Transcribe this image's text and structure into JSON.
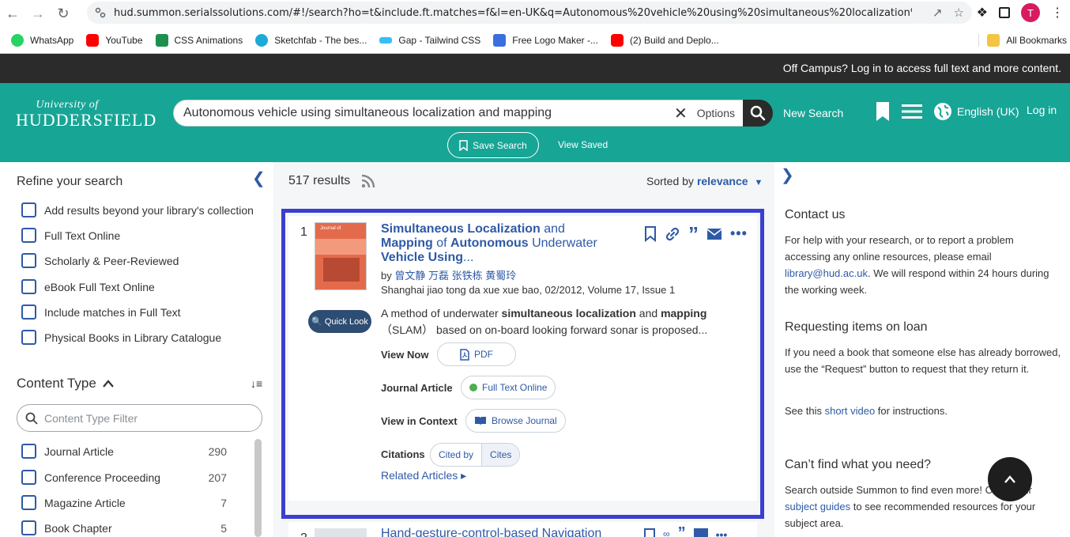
{
  "browser": {
    "url": "hud.summon.serialssolutions.com/#!/search?ho=t&include.ft.matches=f&l=en-UK&q=Autonomous%20vehicle%20using%20simultaneous%20localization%20and...",
    "profile_initial": "T",
    "bookmarks": [
      {
        "label": "WhatsApp",
        "color": "#25d366"
      },
      {
        "label": "YouTube",
        "color": "#ff0000"
      },
      {
        "label": "CSS Animations",
        "color": "#1f8f4e"
      },
      {
        "label": "Sketchfab - The bes...",
        "color": "#1caad9"
      },
      {
        "label": "Gap - Tailwind CSS",
        "color": "#38bdf8"
      },
      {
        "label": "Free Logo Maker -...",
        "color": "#3b6fe0"
      },
      {
        "label": "(2) Build and Deplo...",
        "color": "#ff0000"
      }
    ],
    "all_bookmarks": "All Bookmarks"
  },
  "site": {
    "offcampus": "Off Campus? Log in to access full text and more content.",
    "logo_line1": "University of",
    "logo_line2": "HUDDERSFIELD",
    "search_query": "Autonomous vehicle using simultaneous localization and mapping",
    "options": "Options",
    "new_search": "New Search",
    "language": "English (UK)",
    "login": "Log in",
    "save_search": "Save Search",
    "view_saved": "View Saved"
  },
  "sidebar": {
    "title": "Refine your search",
    "filters": [
      "Add results beyond your library's collection",
      "Full Text Online",
      "Scholarly & Peer-Reviewed",
      "eBook Full Text Online",
      "Include matches in Full Text",
      "Physical Books in Library Catalogue"
    ],
    "content_type_title": "Content Type",
    "content_type_placeholder": "Content Type Filter",
    "content_types": [
      {
        "label": "Journal Article",
        "count": "290"
      },
      {
        "label": "Conference Proceeding",
        "count": "207"
      },
      {
        "label": "Magazine Article",
        "count": "7"
      },
      {
        "label": "Book Chapter",
        "count": "5"
      }
    ]
  },
  "results": {
    "count": "517 results",
    "sorted_by": "Sorted by",
    "sort_value": "relevance",
    "item1": {
      "number": "1",
      "title_parts": [
        {
          "text": "Simultaneous Localization",
          "bold": true
        },
        {
          "text": " and ",
          "bold": false
        },
        {
          "text": "Mapping",
          "bold": true
        },
        {
          "text": " of ",
          "bold": false
        },
        {
          "text": "Autonomous",
          "bold": true
        },
        {
          "text": " Underwater ",
          "bold": false
        },
        {
          "text": "Vehicle Using",
          "bold": true
        },
        {
          "text": "...",
          "bold": false
        }
      ],
      "authors_prefix": "by",
      "authors": "曾文静 万磊 张铁栋 黄蜀玲",
      "publication": "Shanghai jiao tong da xue xue bao, 02/2012, Volume 17, Issue 1",
      "quick_look": "Quick Look",
      "abstract_parts": [
        {
          "text": "A method of underwater ",
          "bold": false
        },
        {
          "text": "simultaneous localization",
          "bold": true
        },
        {
          "text": " and ",
          "bold": false
        },
        {
          "text": "mapping",
          "bold": true
        },
        {
          "text": " （SLAM） based on on-board looking forward sonar is proposed...",
          "bold": false
        }
      ],
      "view_now_label": "View Now",
      "pdf": "PDF",
      "type_label": "Journal Article",
      "full_text": "Full Text Online",
      "context_label": "View in Context",
      "browse_journal": "Browse Journal",
      "citations_label": "Citations",
      "cited_by": "Cited by",
      "cites": "Cites",
      "related": "Related Articles ▸"
    },
    "item2": {
      "number": "2",
      "title": "Hand-gesture-control-based Navigation"
    }
  },
  "right_panel": {
    "contact_title": "Contact us",
    "contact_text_a": "For help with your research, or to report a problem accessing any online resources, please email ",
    "contact_email": "library@hud.ac.uk",
    "contact_text_b": ". We will respond within 24 hours during the working week.",
    "loan_title": "Requesting items on loan",
    "loan_text": "If you need a book that someone else has already borrowed, use the “Request” button to request that they return it.",
    "see_text_a": "See this ",
    "see_link": "short video",
    "see_text_b": " for instructions.",
    "cant_find_title": "Can’t find what you need?",
    "cant_find_text_a": "Search outside Summon to find even more! Check our ",
    "cant_find_link": "subject guides",
    "cant_find_text_b": " to see recommended resources for your subject area."
  },
  "colors": {
    "header_teal": "#17a596",
    "link_blue": "#2e5aa6",
    "highlight_border": "#3b3fcf"
  }
}
